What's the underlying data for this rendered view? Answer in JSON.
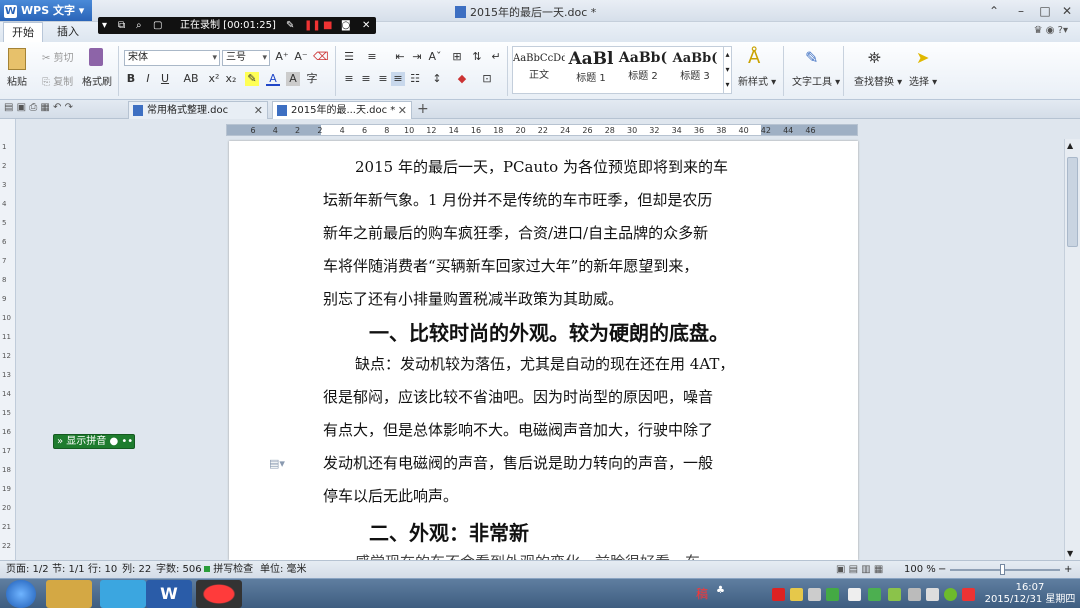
{
  "app": {
    "name": "WPS 文字",
    "doc_title": "2015年的最后一天.doc *"
  },
  "recorder": {
    "status": "正在录制 [00:01:25]"
  },
  "ribbon_tabs": [
    "开始",
    "插入"
  ],
  "ribbon": {
    "paste": "粘贴",
    "cut": "剪切",
    "copy": "复制",
    "format_painter": "格式刷",
    "font": "宋体",
    "size": "三号",
    "styles": [
      {
        "sample": "AaBbCcDd",
        "name": "正文"
      },
      {
        "sample": "AaBl",
        "name": "标题 1"
      },
      {
        "sample": "AaBb(",
        "name": "标题 2"
      },
      {
        "sample": "AaBb(",
        "name": "标题 3"
      }
    ],
    "new_style": "新样式",
    "text_tools": "文字工具",
    "find_replace": "查找替换",
    "select": "选择"
  },
  "doc_tabs": [
    {
      "label": "常用格式整理.doc"
    },
    {
      "label": "2015年的最...天.doc *"
    }
  ],
  "ruler_numbers": [
    "6",
    "4",
    "2",
    "2",
    "4",
    "6",
    "8",
    "10",
    "12",
    "14",
    "16",
    "18",
    "20",
    "22",
    "24",
    "26",
    "28",
    "30",
    "32",
    "34",
    "36",
    "38",
    "40",
    "42",
    "44",
    "46"
  ],
  "document": {
    "p1": [
      "2015 年的最后一天，PCauto 为各位预览即将到来的车",
      "坛新年新气象。1 月份并不是传统的车市旺季，但却是农历",
      "新年之前最后的购车疯狂季，合资/进口/自主品牌的众多新",
      "车将伴随消费者“买辆新车回家过大年”的新年愿望到来，",
      "别忘了还有小排量购置税减半政策为其助威。"
    ],
    "h1": "一、比较时尚的外观。较为硬朗的底盘。",
    "p2": [
      "缺点：发动机较为落伍，尤其是自动的现在还在用 4AT，",
      "很是郁闷，应该比较不省油吧。因为时尚型的原因吧，噪音",
      "有点大，但是总体影响不大。电磁阀声音加大，行驶中除了",
      "发动机还有电磁阀的声音，售后说是助力转向的声音，一般",
      "停车以后无此响声。"
    ],
    "h2": "二、外观：非常新",
    "p3_partial": "感觉现在的车不会看到外观的变化，前脸很好看，车"
  },
  "pinyin_widget": "显示拼音",
  "status": {
    "page": "页面: 1/2",
    "section": "节: 1/1",
    "row": "行: 10",
    "col": "列: 22",
    "words": "字数: 506",
    "spell": "拼写检查",
    "unit": "单位: 毫米",
    "zoom": "100 %"
  },
  "taskbar": {
    "time": "16:07",
    "date": "2015/12/31 星期四"
  }
}
